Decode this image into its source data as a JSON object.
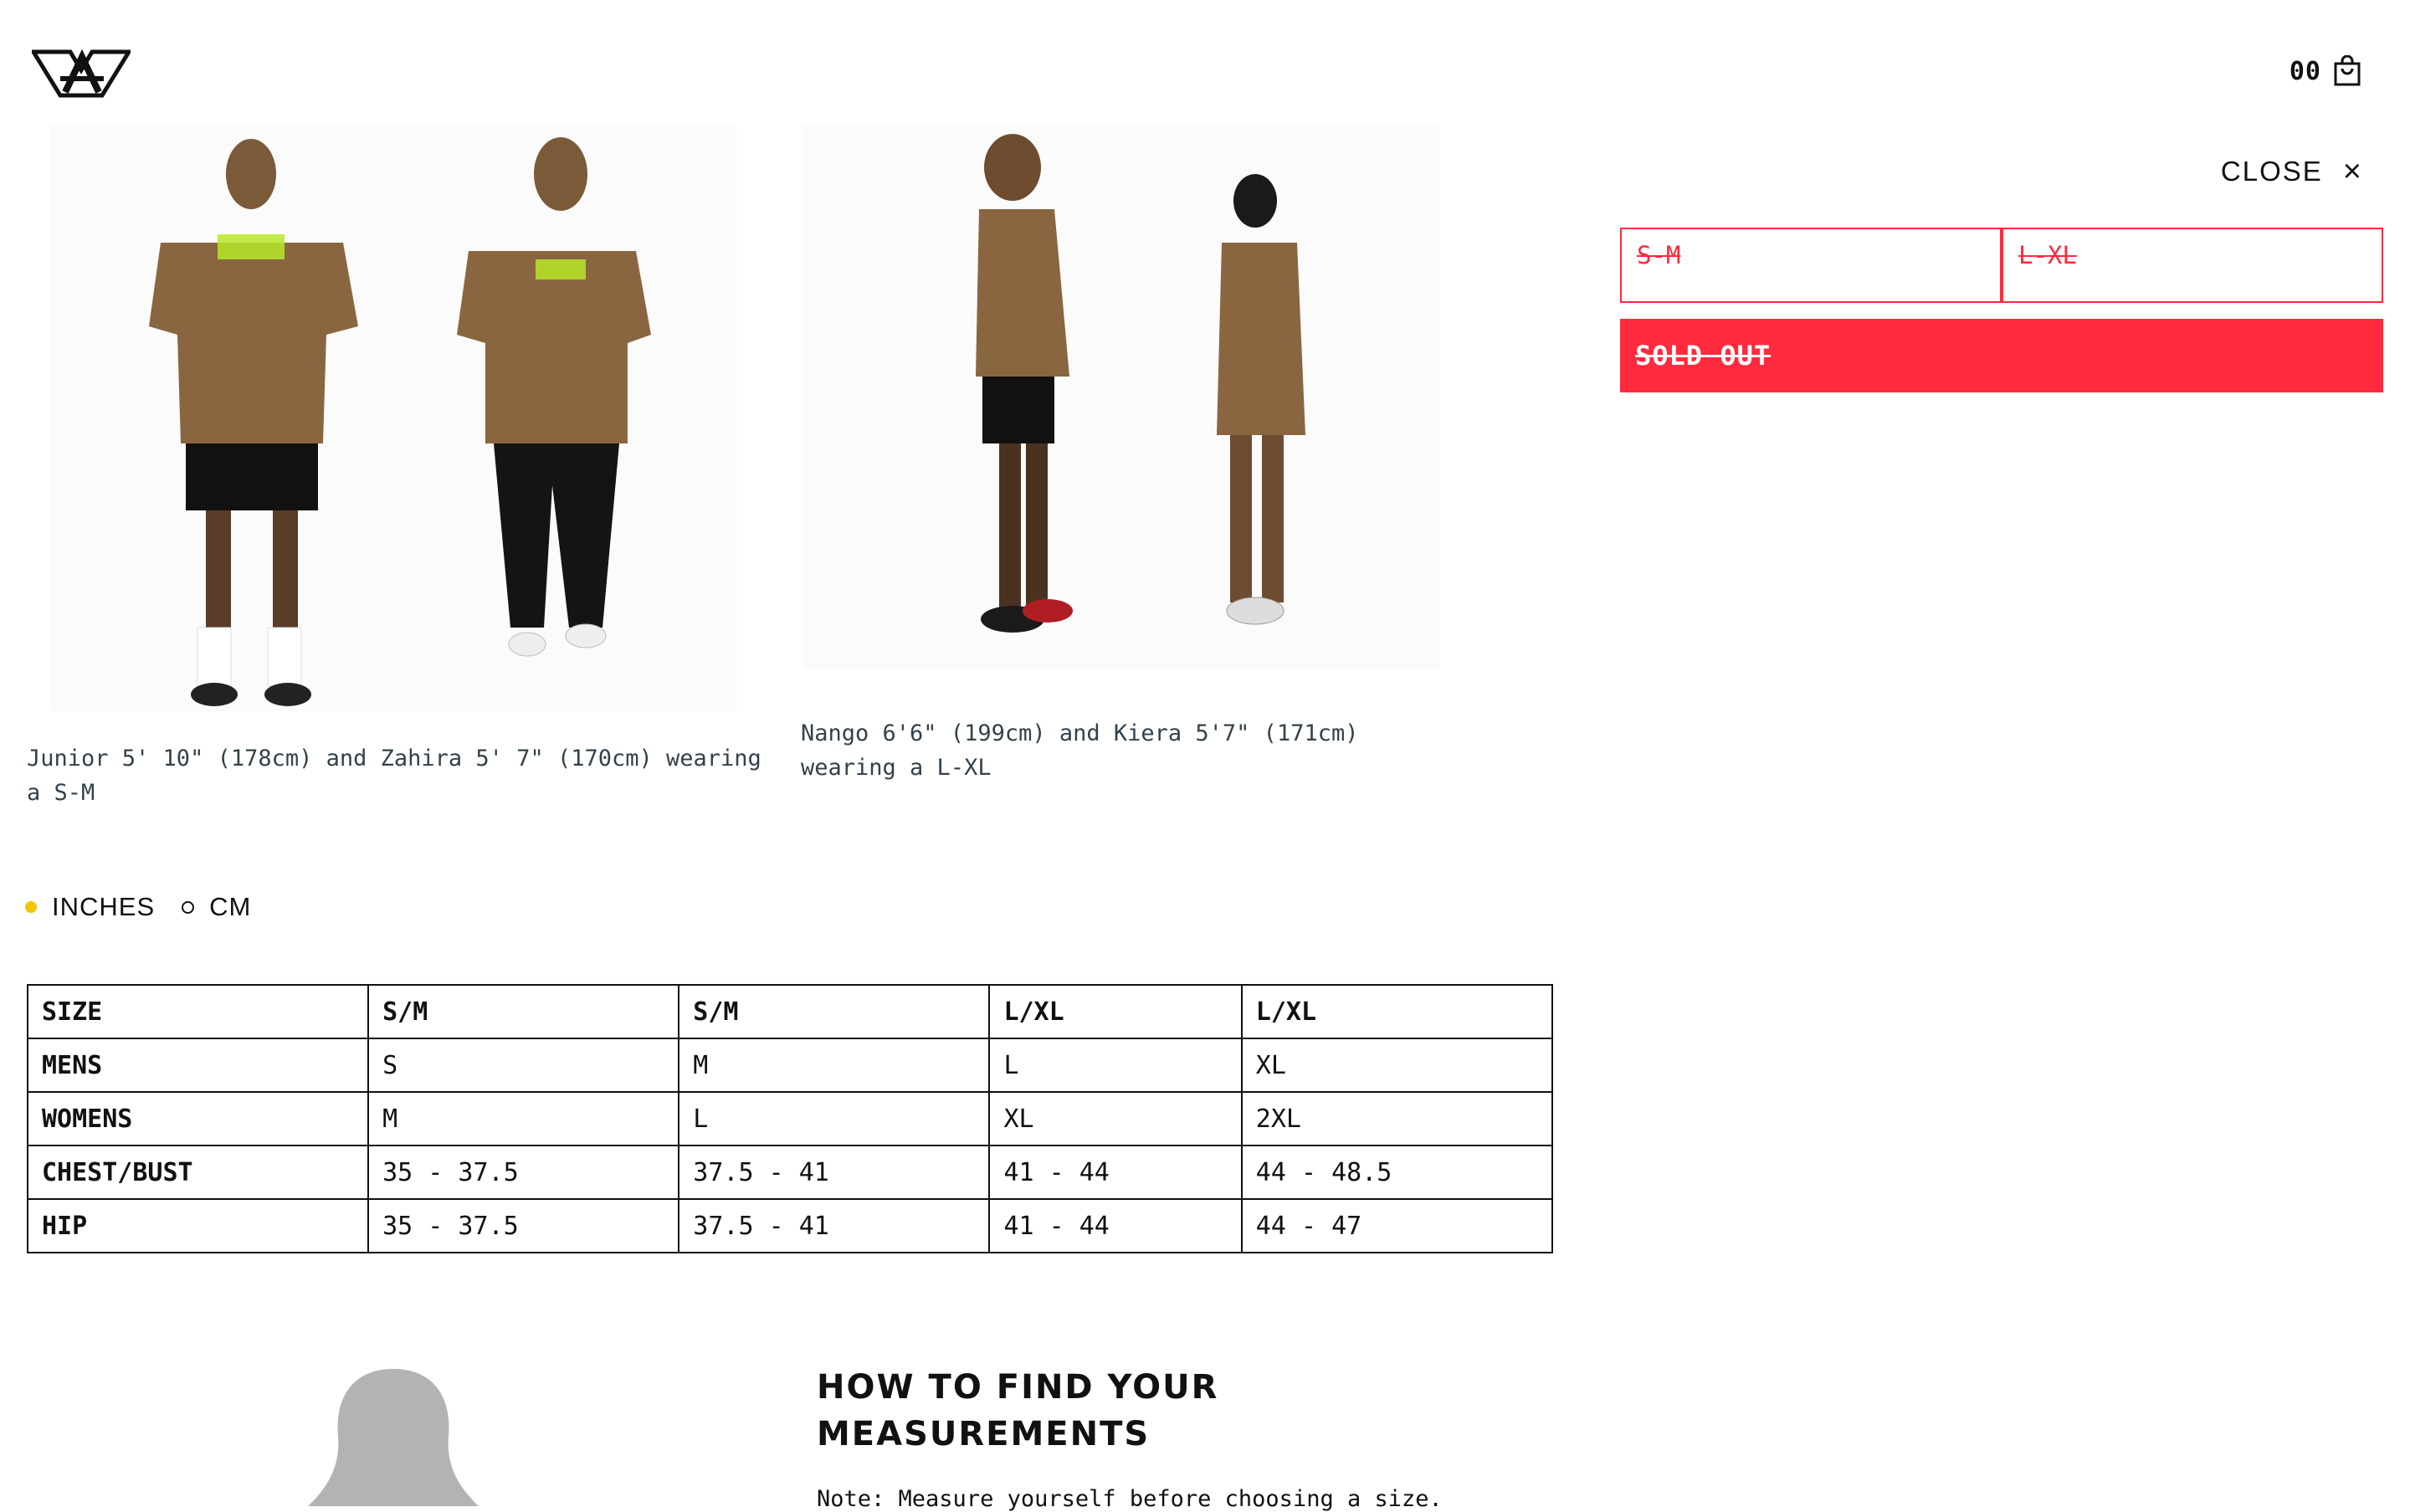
{
  "header": {
    "cart_count": "00",
    "accent": "#ff2a3d"
  },
  "captions": {
    "a": "Junior 5' 10\" (178cm) and Zahira 5' 7\" (170cm) wearing a S-M",
    "b": "Nango 6'6\" (199cm) and Kiera 5'7\" (171cm) wearing a L-XL"
  },
  "units": {
    "inches": "INCHES",
    "cm": "CM",
    "selected": "INCHES"
  },
  "table": {
    "rows": [
      [
        "SIZE",
        "S/M",
        "S/M",
        "L/XL",
        "L/XL"
      ],
      [
        "MENS",
        "S",
        "M",
        "L",
        "XL"
      ],
      [
        "WOMENS",
        "M",
        "L",
        "XL",
        "2XL"
      ],
      [
        "CHEST/BUST",
        "35 - 37.5",
        "37.5 - 41",
        "41 - 44",
        "44 - 48.5"
      ],
      [
        "HIP",
        "35 - 37.5",
        "37.5 - 41",
        "41 - 44",
        "44 - 47"
      ]
    ]
  },
  "howto": {
    "title": "HOW TO FIND YOUR MEASUREMENTS",
    "note": "Note: Measure yourself before choosing a size."
  },
  "panel": {
    "close_label": "CLOSE",
    "close_icon": "×",
    "size_options": [
      "S-M",
      "L-XL"
    ],
    "sold_out_label": "SOLD OUT"
  }
}
